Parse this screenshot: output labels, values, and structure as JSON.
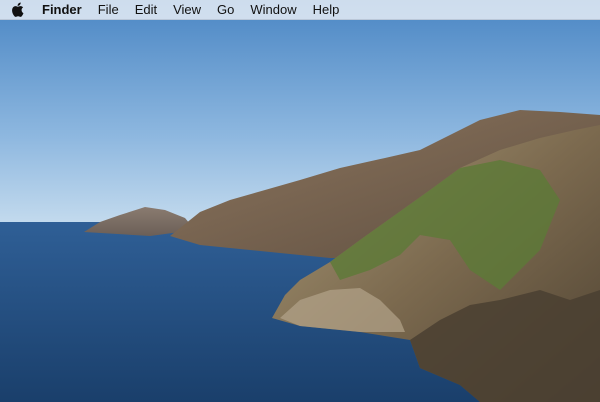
{
  "menubar": {
    "apple_icon": "apple-logo-icon",
    "app_name": "Finder",
    "items": [
      "File",
      "Edit",
      "View",
      "Go",
      "Window",
      "Help"
    ]
  },
  "wallpaper": {
    "subject": "coastal-cliffs-over-ocean",
    "colors": {
      "sky_top": "#4f8cc9",
      "sky_bottom": "#bcd5ec",
      "sea": "#1f4d7f",
      "hills": "#6d5b4a",
      "vegetation": "#5f7d3a"
    }
  }
}
